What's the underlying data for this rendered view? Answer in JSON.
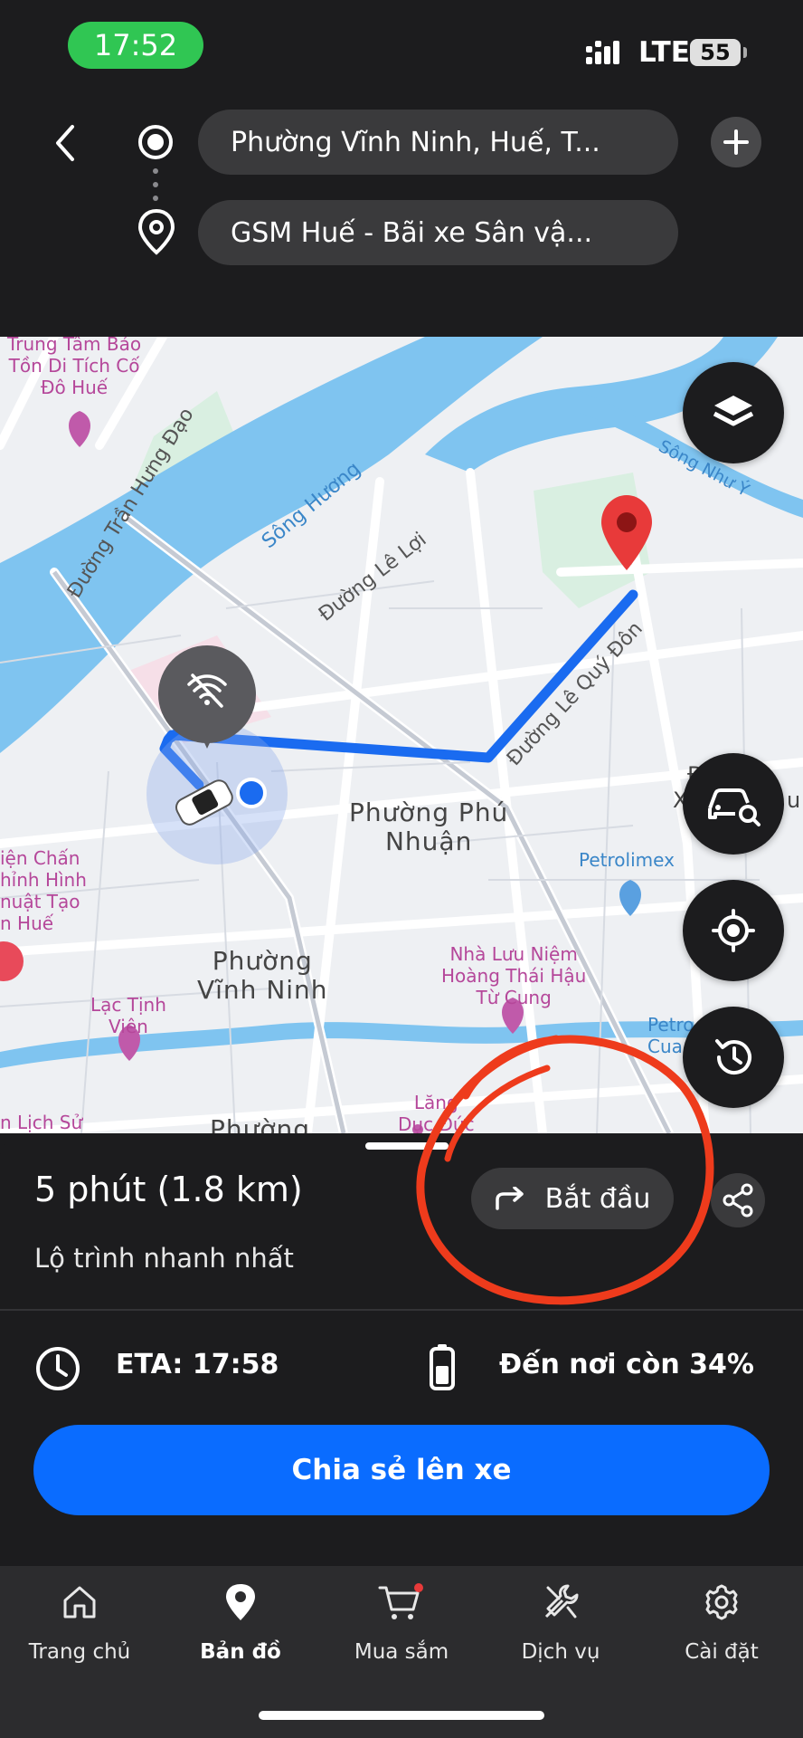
{
  "status_bar": {
    "time": "17:52",
    "network": "LTE",
    "battery": "55"
  },
  "route": {
    "origin": "Phường Vĩnh Ninh, Huế, T...",
    "destination": "GSM Huế - Bãi xe Sân vậ..."
  },
  "map": {
    "labels": {
      "poi_conservation": [
        "Trung Tâm Bảo",
        "Tồn Di Tích Cố",
        "Đô Huế"
      ],
      "street_tran_hung_dao": "Đường Trần Hưng Đạo",
      "river_huong": "Sông Hương",
      "street_le_loi": "Đường Lê Lợi",
      "street_le_quy_don": "Đường Lê Quý Đôn",
      "river_nhu_y": "Sông Như Ý",
      "district_phu_nhuan": [
        "Phường Phú",
        "Nhuận"
      ],
      "district_vinh_ninh": [
        "Phường",
        "Vĩnh Ninh"
      ],
      "poi_petrolimex": "Petrolimex",
      "poi_museum_left": [
        "iện Chấn",
        "hỉnh Hình",
        "nuật Tạo",
        "n Huế"
      ],
      "poi_lac_tinh_vien": [
        "Lạc Tịnh",
        "Viên"
      ],
      "poi_hoang_thai_hau": [
        "Nhà Lưu Niệm",
        "Hoàng Thái Hậu",
        "Từ Cung"
      ],
      "poi_petro_right": [
        "Petro",
        "Cua"
      ],
      "poi_lich_su": "n Lịch Sử",
      "poi_lang_duc_duc": [
        "Lăng",
        "Dục Đức"
      ],
      "district_bottom": "Phường",
      "partial_right": [
        "Đ",
        "X",
        "u"
      ]
    }
  },
  "sheet": {
    "duration": "5 phút (1.8 km)",
    "route_type": "Lộ trình nhanh nhất",
    "start_label": "Bắt đầu",
    "eta": "ETA: 17:58",
    "arrival_battery": "Đến nơi còn 34%",
    "share_to_car": "Chia sẻ lên xe"
  },
  "nav": {
    "items": [
      {
        "label": "Trang chủ",
        "icon": "home-icon"
      },
      {
        "label": "Bản đồ",
        "icon": "map-pin-icon"
      },
      {
        "label": "Mua sắm",
        "icon": "cart-icon"
      },
      {
        "label": "Dịch vụ",
        "icon": "tools-icon"
      },
      {
        "label": "Cài đặt",
        "icon": "gear-icon"
      }
    ],
    "active": "Bản đồ"
  },
  "colors": {
    "accent": "#0a6cff",
    "route": "#1a6bf0",
    "status_green": "#30c653",
    "annotation_red": "#ee3b1c"
  }
}
